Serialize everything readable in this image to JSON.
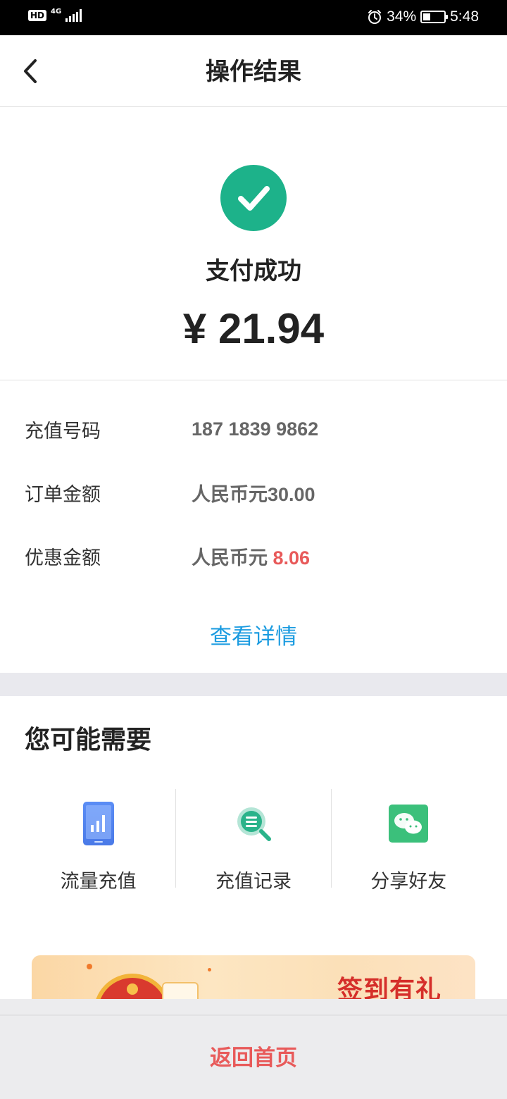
{
  "status_bar": {
    "hd": "HD",
    "network": "4G",
    "alarm_icon": "alarm-clock-icon",
    "battery_percent": "34%",
    "battery_level": 0.34,
    "time": "5:48"
  },
  "header": {
    "back_icon": "chevron-left-icon",
    "title": "操作结果"
  },
  "result": {
    "icon": "check-circle-icon",
    "icon_color": "#1db28a",
    "status": "支付成功",
    "amount": "¥ 21.94"
  },
  "details": {
    "rows": [
      {
        "label": "充值号码",
        "value": "187 1839 9862",
        "value_suffix": ""
      },
      {
        "label": "订单金额",
        "value": "人民币元30.00",
        "value_suffix": ""
      },
      {
        "label": "优惠金额",
        "value": "人民币元 ",
        "value_suffix": "8.06"
      }
    ],
    "view_details": "查看详情",
    "link_color": "#1a9be0",
    "highlight_color": "#e85a5a"
  },
  "maybe": {
    "title": "您可能需要",
    "shortcuts": [
      {
        "label": "流量充值",
        "icon": "phone-data-icon"
      },
      {
        "label": "充值记录",
        "icon": "search-record-icon"
      },
      {
        "label": "分享好友",
        "icon": "wechat-icon"
      }
    ],
    "banner": {
      "text": "签到有礼"
    }
  },
  "footer": {
    "home_button": "返回首页"
  }
}
